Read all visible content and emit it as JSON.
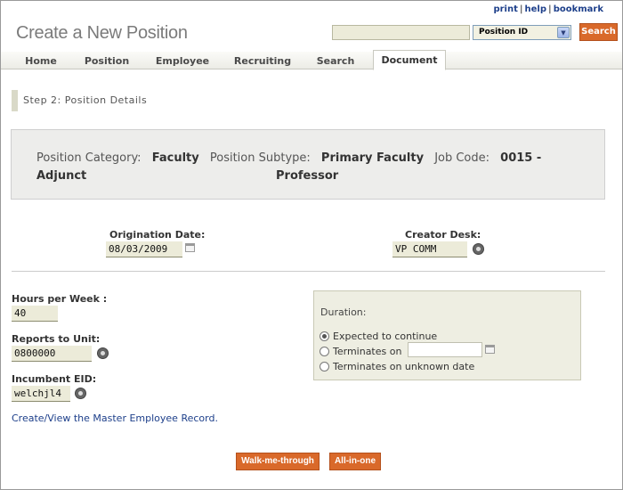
{
  "utility_links": {
    "print": "print",
    "help": "help",
    "bookmark": "bookmark",
    "separator": "|"
  },
  "header": {
    "title": "Create a New Position",
    "search_value": "",
    "search_type": "Position ID",
    "search_button": "Search"
  },
  "tabs": [
    {
      "label": "Home"
    },
    {
      "label": "Position"
    },
    {
      "label": "Employee"
    },
    {
      "label": "Recruiting"
    },
    {
      "label": "Search"
    },
    {
      "label": "Document",
      "active": true
    }
  ],
  "step_label": "Step 2: Position Details",
  "category": {
    "category_label": "Position Category:",
    "category_value": "Faculty",
    "subtype_label": "Position Subtype:",
    "subtype_value": "Primary Faculty",
    "jobcode_label": "Job Code:",
    "jobcode_value": "0015 - Adjunct",
    "jobcode_value_line2": "Professor"
  },
  "origination": {
    "label": "Origination Date:",
    "value": "08/03/2009"
  },
  "creator": {
    "label": "Creator Desk:",
    "value": "VP COMM"
  },
  "hours": {
    "label": "Hours per Week :",
    "value": "40"
  },
  "reports": {
    "label": "Reports to Unit:",
    "value": "0800000"
  },
  "incumbent": {
    "label": "Incumbent EID:",
    "value": "welchjl4"
  },
  "duration": {
    "title": "Duration:",
    "options": [
      {
        "label": "Expected to continue",
        "selected": true
      },
      {
        "label": "Terminates on",
        "selected": false
      },
      {
        "label": "Terminates on unknown date",
        "selected": false
      }
    ],
    "terminates_date": ""
  },
  "master_link": "Create/View the Master Employee Record.",
  "buttons": {
    "walk": "Walk-me-through",
    "allinone": "All-in-one"
  },
  "colors": {
    "accent": "#d9692a",
    "link": "#1d3f8a",
    "field_bg": "#ecebd9"
  },
  "icons": [
    "calendar-icon",
    "magnifier-icon",
    "dropdown-arrow-icon"
  ]
}
